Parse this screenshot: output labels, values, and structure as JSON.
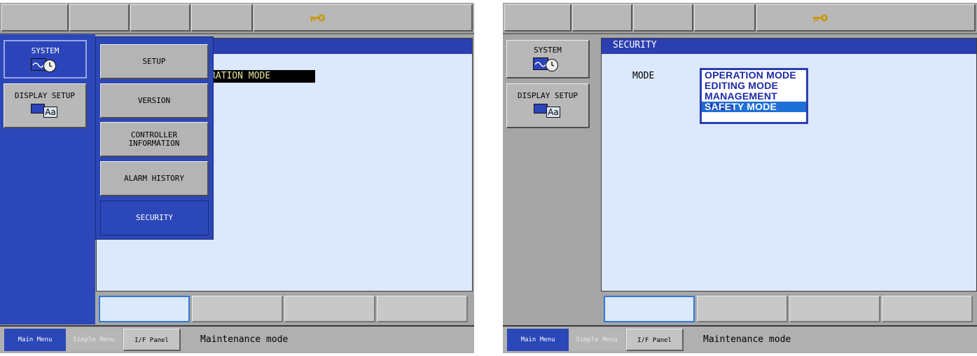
{
  "left": {
    "leftmenu": {
      "system_label": "SYSTEM",
      "display_setup_label": "DISPLAY SETUP",
      "aa_text": "Aa"
    },
    "submenu": {
      "items": [
        {
          "label": "SETUP"
        },
        {
          "label": "VERSION"
        },
        {
          "label": "CONTROLLER\nINFORMATION"
        },
        {
          "label": "ALARM HISTORY"
        },
        {
          "label": "SECURITY"
        }
      ]
    },
    "main": {
      "mode_value_visible": "RATION MODE"
    },
    "statusbar": {
      "main_menu": "Main Menu",
      "simple_menu": "Simple Menu",
      "if_panel": "I/F Panel",
      "status_text": "Maintenance mode"
    }
  },
  "right": {
    "leftmenu": {
      "system_label": "SYSTEM",
      "display_setup_label": "DISPLAY SETUP",
      "aa_text": "Aa"
    },
    "main": {
      "title": "SECURITY",
      "mode_label": "MODE",
      "mode_options": [
        "OPERATION MODE",
        "EDITING MODE",
        "MANAGEMENT MODE",
        "SAFETY MODE"
      ],
      "selected_option": "SAFETY MODE"
    },
    "statusbar": {
      "main_menu": "Main Menu",
      "simple_menu": "Simple Menu",
      "if_panel": "I/F Panel",
      "status_text": "Maintenance mode"
    }
  },
  "colors": {
    "menu_blue": "#2b47b8",
    "panel_bg": "#dce8fb",
    "selection": "#1e6fd6",
    "key_icon": "#c89a12"
  }
}
